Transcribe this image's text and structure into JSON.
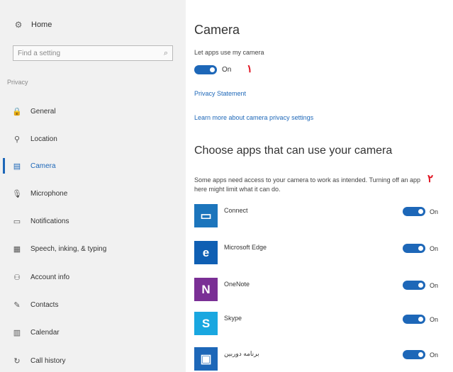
{
  "sidebar": {
    "home_label": "Home",
    "search_placeholder": "Find a setting",
    "section_label": "Privacy",
    "items": [
      {
        "label": "General",
        "icon": "lock-icon"
      },
      {
        "label": "Location",
        "icon": "location-icon"
      },
      {
        "label": "Camera",
        "icon": "camera-icon"
      },
      {
        "label": "Microphone",
        "icon": "microphone-icon"
      },
      {
        "label": "Notifications",
        "icon": "notification-icon"
      },
      {
        "label": "Speech, inking, & typing",
        "icon": "speech-icon"
      },
      {
        "label": "Account info",
        "icon": "account-icon"
      },
      {
        "label": "Contacts",
        "icon": "contacts-icon"
      },
      {
        "label": "Calendar",
        "icon": "calendar-icon"
      },
      {
        "label": "Call history",
        "icon": "history-icon"
      }
    ],
    "active_index": 2
  },
  "main": {
    "title": "Camera",
    "let_apps_label": "Let apps use my camera",
    "main_toggle_state": "On",
    "marker1": "١",
    "privacy_link": "Privacy Statement",
    "learn_more_link": "Learn more about camera privacy settings",
    "apps_heading": "Choose apps that can use your camera",
    "apps_description": "Some apps need access to your camera to work as intended. Turning off an app here might limit what it can do.",
    "marker2": "٢",
    "apps": [
      {
        "name": "Connect",
        "state": "On",
        "icon_color": "#1c75bc",
        "icon_glyph": "▭"
      },
      {
        "name": "Microsoft Edge",
        "state": "On",
        "icon_color": "#0f5fb3",
        "icon_glyph": "e"
      },
      {
        "name": "OneNote",
        "state": "On",
        "icon_color": "#7a2f95",
        "icon_glyph": "N"
      },
      {
        "name": "Skype",
        "state": "On",
        "icon_color": "#19a7e0",
        "icon_glyph": "S"
      },
      {
        "name": "برنامه دوربین",
        "state": "On",
        "icon_color": "#1d67b8",
        "icon_glyph": "▣"
      }
    ]
  },
  "colors": {
    "accent": "#1d67b8",
    "marker": "#e0101e",
    "sidebar_bg": "#f1f1f1"
  }
}
